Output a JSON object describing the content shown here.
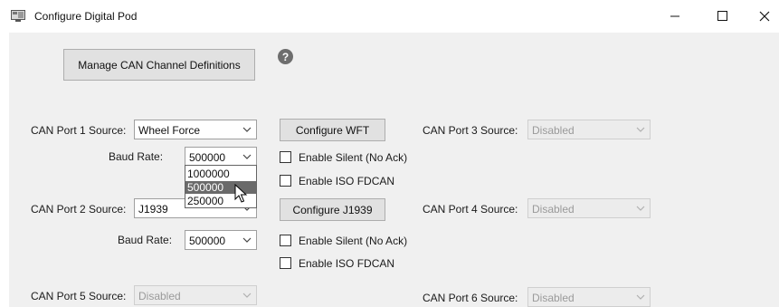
{
  "window": {
    "title": "Configure Digital Pod",
    "icons": {
      "app": "app-icon",
      "minimize": "minimize-icon",
      "maximize": "maximize-icon",
      "close": "close-icon"
    }
  },
  "manage_button": "Manage CAN Channel Definitions",
  "help_icon": {
    "name": "help-icon",
    "glyph": "?"
  },
  "port1": {
    "label": "CAN Port 1 Source:",
    "value": "Wheel Force",
    "baud_label": "Baud Rate:",
    "baud_value": "500000",
    "configure": "Configure WFT",
    "silent": "Enable Silent (No Ack)",
    "iso": "Enable ISO FDCAN"
  },
  "baud_dropdown": {
    "options": [
      "1000000",
      "500000",
      "250000"
    ],
    "selected": "500000"
  },
  "port2": {
    "label": "CAN Port 2 Source:",
    "value": "J1939",
    "baud_label": "Baud Rate:",
    "baud_value": "500000",
    "configure": "Configure J1939",
    "silent": "Enable Silent (No Ack)",
    "iso": "Enable ISO FDCAN"
  },
  "port3": {
    "label": "CAN Port 3 Source:",
    "value": "Disabled"
  },
  "port4": {
    "label": "CAN Port 4 Source:",
    "value": "Disabled"
  },
  "port5": {
    "label": "CAN Port 5 Source:",
    "value": "Disabled"
  },
  "port6": {
    "label": "CAN Port 6 Source:",
    "value": "Disabled"
  },
  "colors": {
    "selection": "#6a6a6a",
    "client_bg": "#f0f0f0",
    "button_bg": "#e1e1e1",
    "disabled_text": "#9a9a9a"
  }
}
